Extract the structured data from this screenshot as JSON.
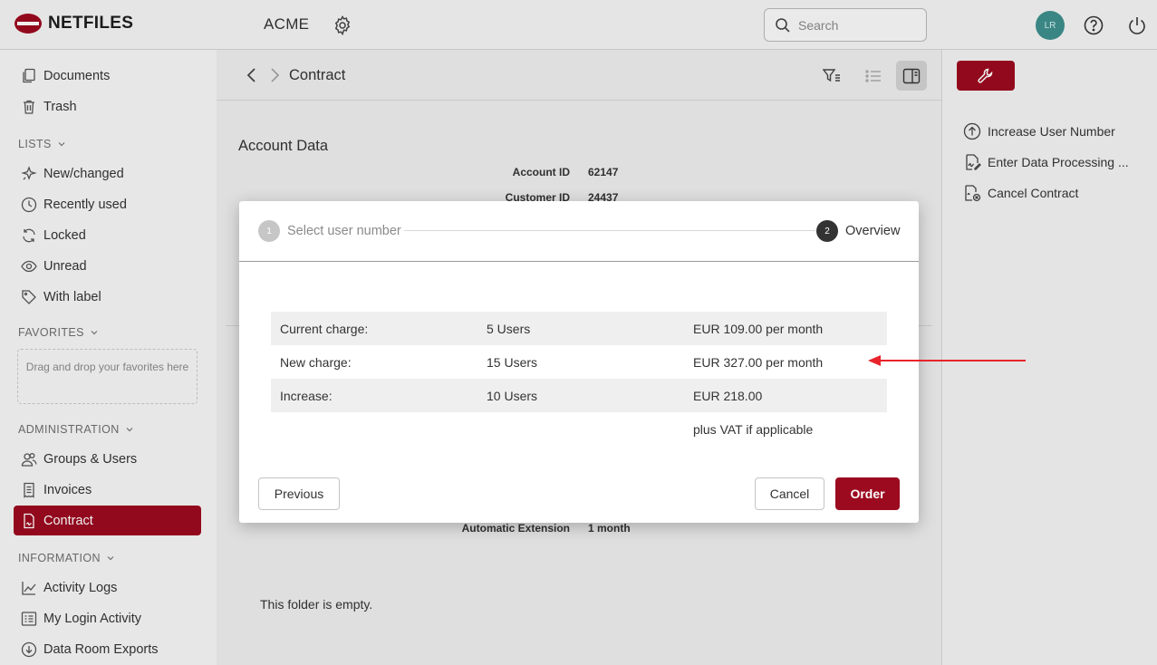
{
  "brand": {
    "name": "NETFILES",
    "accent": "#9c0a1f"
  },
  "header": {
    "org_name": "ACME",
    "search_placeholder": "Search",
    "avatar_initials": "LR"
  },
  "sidebar": {
    "items_top": [
      {
        "label": "Documents",
        "icon": "document-icon"
      },
      {
        "label": "Trash",
        "icon": "trash-icon"
      }
    ],
    "lists_label": "LISTS",
    "lists": [
      {
        "label": "New/changed",
        "icon": "sparkle-icon"
      },
      {
        "label": "Recently used",
        "icon": "clock-icon"
      },
      {
        "label": "Locked",
        "icon": "refresh-icon"
      },
      {
        "label": "Unread",
        "icon": "eye-icon"
      },
      {
        "label": "With label",
        "icon": "tag-icon"
      }
    ],
    "favorites_label": "FAVORITES",
    "favorites_placeholder": "Drag and drop your favorites here",
    "admin_label": "ADMINISTRATION",
    "admin": [
      {
        "label": "Groups & Users",
        "icon": "users-icon"
      },
      {
        "label": "Invoices",
        "icon": "invoice-icon"
      },
      {
        "label": "Contract",
        "icon": "contract-icon",
        "active": true
      }
    ],
    "info_label": "INFORMATION",
    "info": [
      {
        "label": "Activity Logs",
        "icon": "chart-icon"
      },
      {
        "label": "My Login Activity",
        "icon": "login-list-icon"
      },
      {
        "label": "Data Room Exports",
        "icon": "download-icon"
      }
    ]
  },
  "main": {
    "breadcrumb_title": "Contract",
    "account_title": "Account Data",
    "account_id_label": "Account ID",
    "account_id": "62147",
    "customer_id_label": "Customer ID",
    "customer_id": "24437",
    "auto_ext_label": "Automatic Extension",
    "auto_ext_value": "1 month",
    "empty_text": "This folder is empty."
  },
  "right_panel": {
    "actions": [
      {
        "label": "Increase User Number",
        "icon": "arrow-up-circle-icon"
      },
      {
        "label": "Enter Data Processing ...",
        "icon": "signature-icon"
      },
      {
        "label": "Cancel Contract",
        "icon": "cancel-contract-icon"
      }
    ]
  },
  "modal": {
    "step1_num": "1",
    "step1_label": "Select user number",
    "step2_num": "2",
    "step2_label": "Overview",
    "rows": [
      {
        "label": "Current charge:",
        "users": "5 Users",
        "price": "EUR 109.00 per month"
      },
      {
        "label": "New charge:",
        "users": "15 Users",
        "price": "EUR 327.00 per month"
      },
      {
        "label": "Increase:",
        "users": "10 Users",
        "price": "EUR 218.00"
      },
      {
        "label": "",
        "users": "",
        "price": "plus VAT if applicable"
      }
    ],
    "previous_label": "Previous",
    "cancel_label": "Cancel",
    "order_label": "Order"
  }
}
